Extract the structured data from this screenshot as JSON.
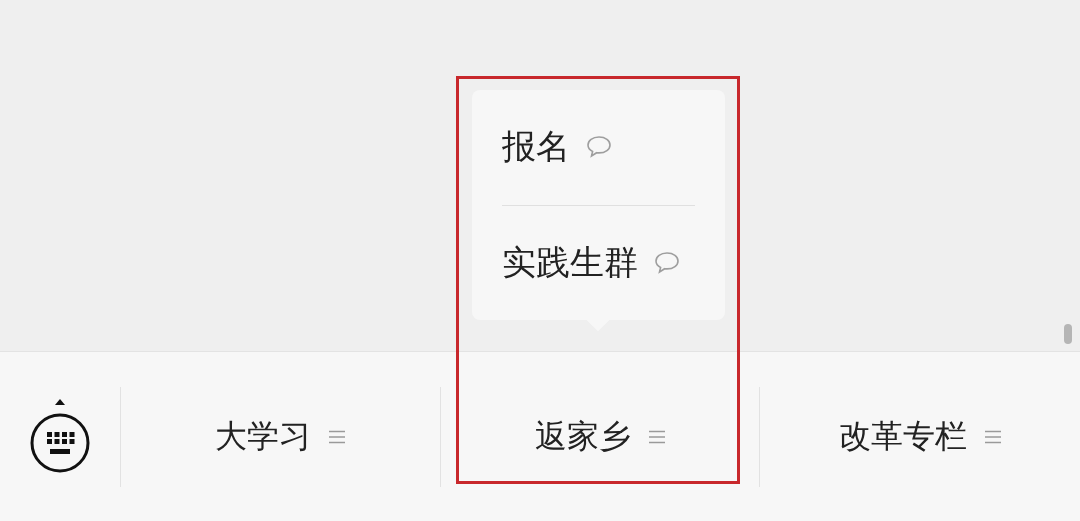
{
  "menu_items": [
    {
      "label": "大学习",
      "highlighted": false
    },
    {
      "label": "返家乡",
      "highlighted": true,
      "submenu": [
        {
          "label": "报名"
        },
        {
          "label": "实践生群"
        }
      ]
    },
    {
      "label": "改革专栏",
      "highlighted": false
    }
  ]
}
